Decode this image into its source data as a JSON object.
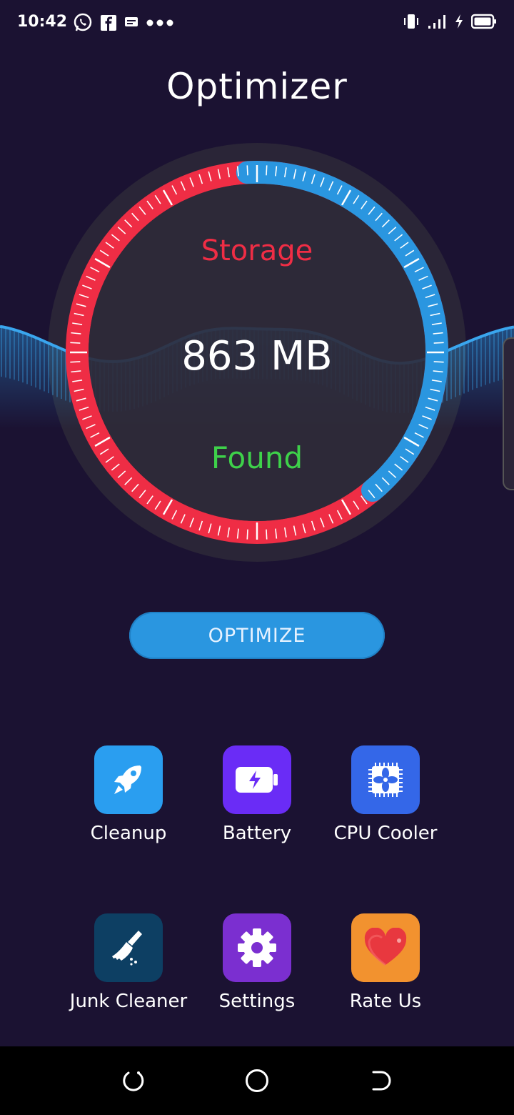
{
  "status_bar": {
    "time": "10:42",
    "icons_left": [
      "whatsapp-icon",
      "facebook-icon",
      "message-icon",
      "more-dots-icon"
    ],
    "icons_right": [
      "vibrate-icon",
      "signal-icon",
      "charging-icon",
      "battery-icon"
    ]
  },
  "app": {
    "title": "Optimizer"
  },
  "gauge": {
    "top_label": "Storage",
    "value": "863 MB",
    "bottom_label": "Found",
    "colors": {
      "used": "#ef2d45",
      "free": "#2a96e0",
      "found": "#3ed14a",
      "wave": "#2a96e0"
    }
  },
  "optimize_button": {
    "label": "OPTIMIZE"
  },
  "features": [
    {
      "label": "Cleanup",
      "icon": "rocket-icon",
      "color": "#2a9ef0"
    },
    {
      "label": "Battery",
      "icon": "battery-charge-icon",
      "color": "#6a2cf6"
    },
    {
      "label": "CPU Cooler",
      "icon": "cpu-fan-icon",
      "color": "#3467e8"
    },
    {
      "label": "Junk Cleaner",
      "icon": "broom-icon",
      "color": "#0d3f63"
    },
    {
      "label": "Settings",
      "icon": "gear-icon",
      "color": "#7b2fd0"
    },
    {
      "label": "Rate Us",
      "icon": "heart-icon",
      "color": "#f2922f"
    }
  ],
  "nav_bar": {
    "icons": [
      "recent-apps-icon",
      "home-icon",
      "back-icon"
    ]
  }
}
